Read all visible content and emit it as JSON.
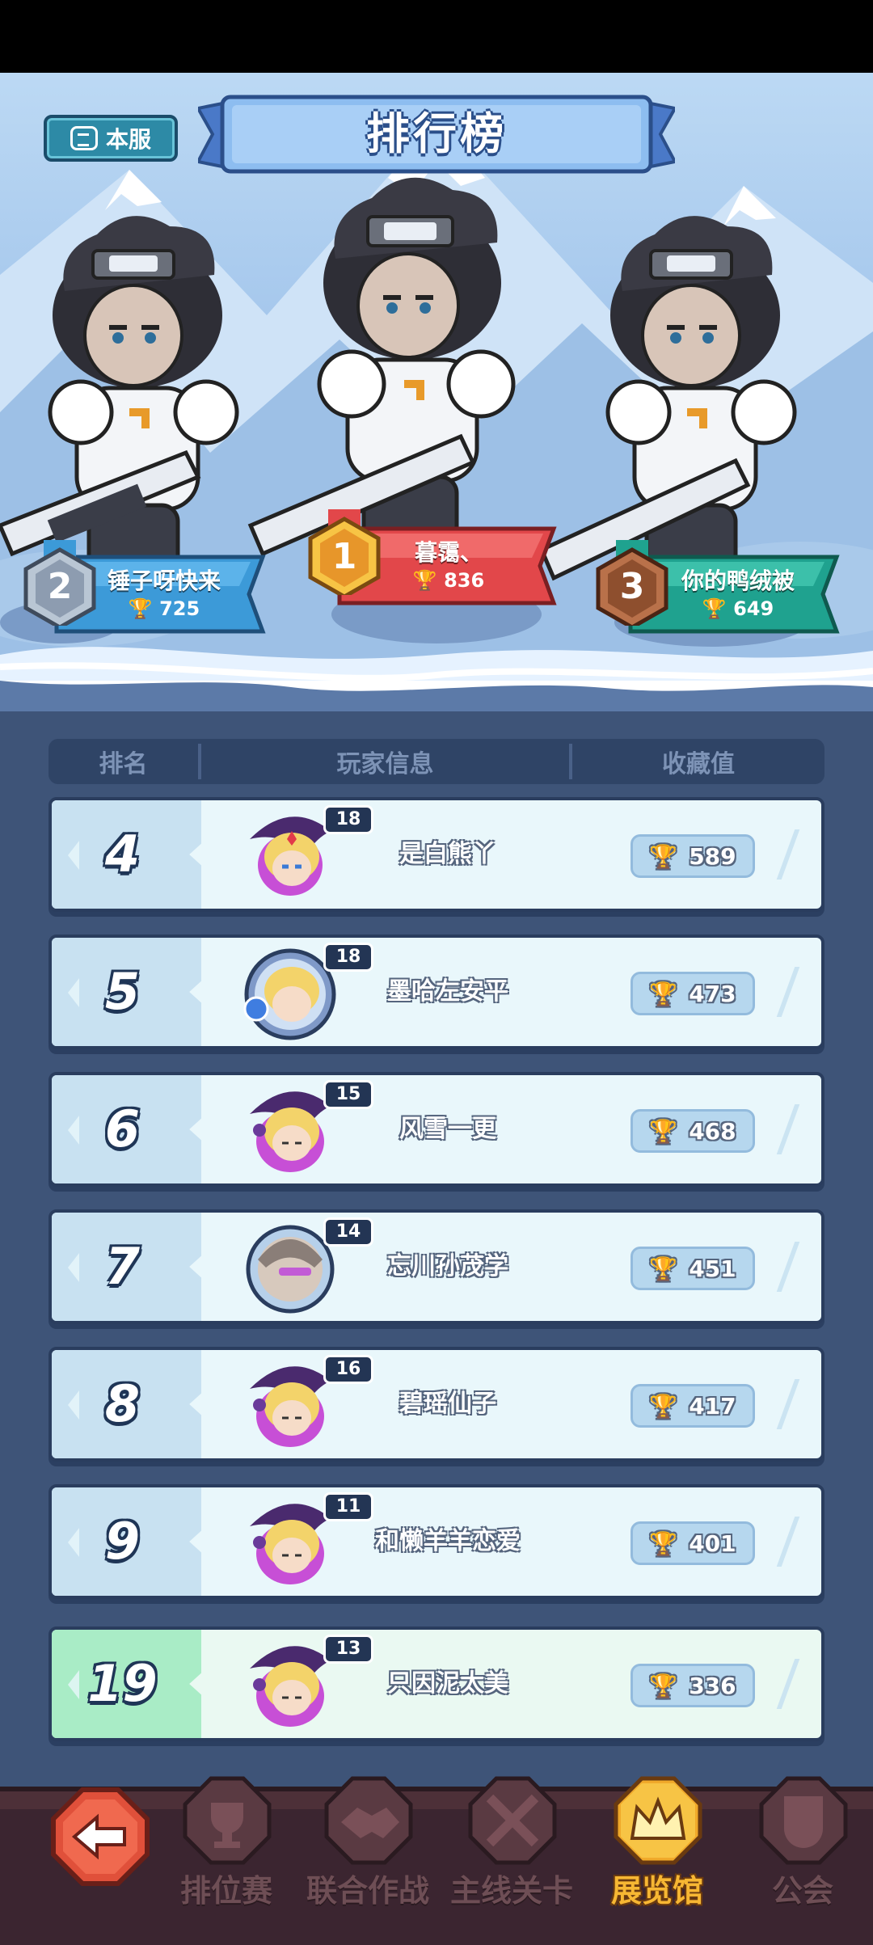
{
  "header": {
    "server_label": "本服",
    "title": "排行榜"
  },
  "podium": [
    {
      "rank": "2",
      "name": "锤子呀快来",
      "score": "725"
    },
    {
      "rank": "1",
      "name": "暮霭、",
      "score": "836"
    },
    {
      "rank": "3",
      "name": "你的鸭绒被",
      "score": "649"
    }
  ],
  "table": {
    "columns": [
      "排名",
      "玩家信息",
      "收藏值"
    ],
    "rows": [
      {
        "rank": "4",
        "level": "18",
        "name": "是白熊丫",
        "score": "589",
        "avatar": "mage-girl-avatar"
      },
      {
        "rank": "5",
        "level": "18",
        "name": "墨哈左安平",
        "score": "473",
        "avatar": "blonde-ring-avatar"
      },
      {
        "rank": "6",
        "level": "15",
        "name": "风雪一更",
        "score": "468",
        "avatar": "blonde-girl-avatar"
      },
      {
        "rank": "7",
        "level": "14",
        "name": "忘川孙茂学",
        "score": "451",
        "avatar": "warrior-avatar"
      },
      {
        "rank": "8",
        "level": "16",
        "name": "碧瑶仙子",
        "score": "417",
        "avatar": "blonde-girl-avatar"
      },
      {
        "rank": "9",
        "level": "11",
        "name": "和懒羊羊恋爱",
        "score": "401",
        "avatar": "blonde-girl-avatar"
      }
    ],
    "me": {
      "rank": "19",
      "level": "13",
      "name": "只因泥太美",
      "score": "336",
      "avatar": "blonde-girl-avatar"
    }
  },
  "nav": {
    "items": [
      "排位赛",
      "联合作战",
      "主线关卡",
      "展览馆",
      "公会"
    ],
    "active": "展览馆"
  },
  "colors": {
    "panel_bg": "#3e5478",
    "row_bg": "#e9f7fb",
    "me_rank_bg": "#a9ecc6",
    "gold": "#f7b733",
    "red_banner": "#e2474a",
    "blue_banner": "#3c9ad8",
    "green_banner": "#1fa28f"
  }
}
